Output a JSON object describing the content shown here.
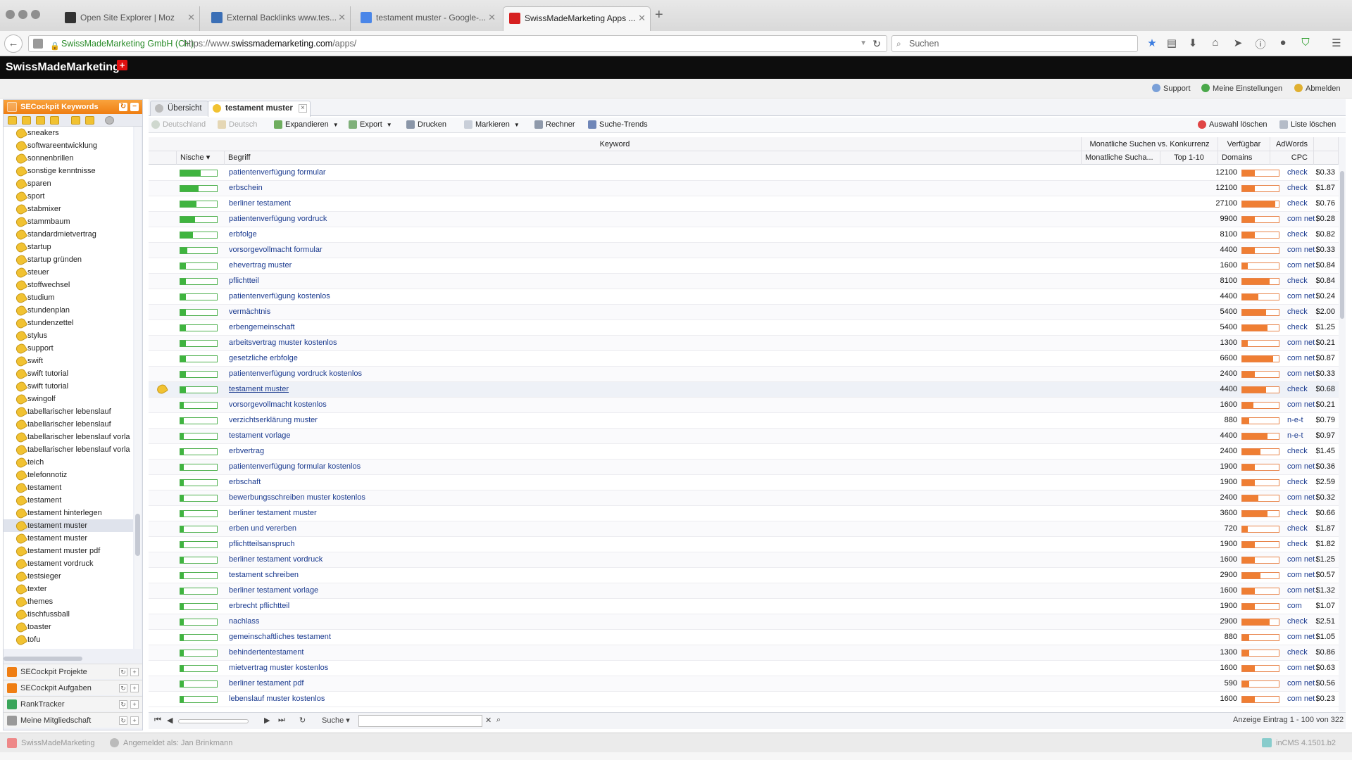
{
  "browser": {
    "tabs": [
      {
        "title": "Open Site Explorer | Moz",
        "active": false
      },
      {
        "title": "External Backlinks www.tes...",
        "active": false
      },
      {
        "title": "testament muster - Google-...",
        "active": false
      },
      {
        "title": "SwissMadeMarketing Apps ...",
        "active": true
      }
    ],
    "new_tab": "+",
    "url_org": "SwissMadeMarketing GmbH (CH)",
    "url_prefix": "https://www.",
    "url_domain": "swissmademarketing.com",
    "url_path": "/apps/",
    "search_placeholder": "Suchen"
  },
  "app": {
    "brand": "SwissMadeMarketing",
    "brand_flag": "+",
    "links": {
      "support": "Support",
      "settings": "Meine Einstellungen",
      "logout": "Abmelden"
    }
  },
  "sidebar": {
    "title": "SECockpit Keywords",
    "keywords": [
      "sneakers",
      "softwareentwicklung",
      "sonnenbrillen",
      "sonstige kenntnisse",
      "sparen",
      "sport",
      "stabmixer",
      "stammbaum",
      "standardmietvertrag",
      "startup",
      "startup gründen",
      "steuer",
      "stoffwechsel",
      "studium",
      "stundenplan",
      "stundenzettel",
      "stylus",
      "support",
      "swift",
      "swift tutorial",
      "swift tutorial",
      "swingolf",
      "tabellarischer lebenslauf",
      "tabellarischer lebenslauf",
      "tabellarischer lebenslauf vorla",
      "tabellarischer lebenslauf vorla",
      "teich",
      "telefonnotiz",
      "testament",
      "testament",
      "testament hinterlegen",
      "testament muster",
      "testament muster",
      "testament muster pdf",
      "testament vordruck",
      "testsieger",
      "texter",
      "themes",
      "tischfussball",
      "toaster",
      "tofu"
    ],
    "selected_index": 31,
    "sections": [
      "SECockpit Projekte",
      "SECockpit Aufgaben",
      "RankTracker",
      "Meine Mitgliedschaft"
    ]
  },
  "content": {
    "tabs": {
      "overview": "Übersicht",
      "active": "testament muster",
      "close": "×"
    },
    "toolbar": {
      "country": "Deutschland",
      "language": "Deutsch",
      "expand": "Expandieren",
      "export": "Export",
      "print": "Drucken",
      "mark": "Markieren",
      "calculator": "Rechner",
      "trends": "Suche-Trends",
      "clear_selection": "Auswahl löschen",
      "clear_list": "Liste löschen"
    },
    "groups": {
      "keyword": "Keyword",
      "monthly": "Monatliche Suchen vs. Konkurrenz",
      "available": "Verfügbar",
      "adwords": "AdWords"
    },
    "columns": {
      "niche": "Nische",
      "term": "Begriff",
      "monthly": "Monatliche Sucha...",
      "top": "Top 1-10",
      "domains": "Domains",
      "cpc": "CPC"
    },
    "rows": [
      {
        "term": "patientenverfügung formular",
        "volume": "12100",
        "domains": "check",
        "cpc": "$0.33",
        "niche": 0.55,
        "comp": 0.35
      },
      {
        "term": "erbschein",
        "volume": "12100",
        "domains": "check",
        "cpc": "$1.87",
        "niche": 0.5,
        "comp": 0.35
      },
      {
        "term": "berliner testament",
        "volume": "27100",
        "domains": "check",
        "cpc": "$0.76",
        "niche": 0.45,
        "comp": 0.9
      },
      {
        "term": "patientenverfügung vordruck",
        "volume": "9900",
        "domains": "com net",
        "cpc": "$0.28",
        "niche": 0.4,
        "comp": 0.35
      },
      {
        "term": "erbfolge",
        "volume": "8100",
        "domains": "check",
        "cpc": "$0.82",
        "niche": 0.35,
        "comp": 0.35
      },
      {
        "term": "vorsorgevollmacht formular",
        "volume": "4400",
        "domains": "com net",
        "cpc": "$0.33",
        "niche": 0.2,
        "comp": 0.35
      },
      {
        "term": "ehevertrag muster",
        "volume": "1600",
        "domains": "com net",
        "cpc": "$0.84",
        "niche": 0.15,
        "comp": 0.15
      },
      {
        "term": "pflichtteil",
        "volume": "8100",
        "domains": "check",
        "cpc": "$0.84",
        "niche": 0.15,
        "comp": 0.75
      },
      {
        "term": "patientenverfügung kostenlos",
        "volume": "4400",
        "domains": "com net",
        "cpc": "$0.24",
        "niche": 0.15,
        "comp": 0.45
      },
      {
        "term": "vermächtnis",
        "volume": "5400",
        "domains": "check",
        "cpc": "$2.00",
        "niche": 0.15,
        "comp": 0.65
      },
      {
        "term": "erbengemeinschaft",
        "volume": "5400",
        "domains": "check",
        "cpc": "$1.25",
        "niche": 0.15,
        "comp": 0.7
      },
      {
        "term": "arbeitsvertrag muster kostenlos",
        "volume": "1300",
        "domains": "com net",
        "cpc": "$0.21",
        "niche": 0.15,
        "comp": 0.15
      },
      {
        "term": "gesetzliche erbfolge",
        "volume": "6600",
        "domains": "com net",
        "cpc": "$0.87",
        "niche": 0.15,
        "comp": 0.85
      },
      {
        "term": "patientenverfügung vordruck kostenlos",
        "volume": "2400",
        "domains": "com net",
        "cpc": "$0.33",
        "niche": 0.15,
        "comp": 0.35
      },
      {
        "term": "testament muster",
        "volume": "4400",
        "domains": "check",
        "cpc": "$0.68",
        "niche": 0.15,
        "comp": 0.65
      },
      {
        "term": "vorsorgevollmacht kostenlos",
        "volume": "1600",
        "domains": "com net",
        "cpc": "$0.21",
        "niche": 0.1,
        "comp": 0.3
      },
      {
        "term": "verzichtserklärung muster",
        "volume": "880",
        "domains": "n-e-t",
        "cpc": "$0.79",
        "niche": 0.1,
        "comp": 0.2
      },
      {
        "term": "testament vorlage",
        "volume": "4400",
        "domains": "n-e-t",
        "cpc": "$0.97",
        "niche": 0.1,
        "comp": 0.7
      },
      {
        "term": "erbvertrag",
        "volume": "2400",
        "domains": "check",
        "cpc": "$1.45",
        "niche": 0.1,
        "comp": 0.5
      },
      {
        "term": "patientenverfügung formular kostenlos",
        "volume": "1900",
        "domains": "com net",
        "cpc": "$0.36",
        "niche": 0.1,
        "comp": 0.35
      },
      {
        "term": "erbschaft",
        "volume": "1900",
        "domains": "check",
        "cpc": "$2.59",
        "niche": 0.1,
        "comp": 0.35
      },
      {
        "term": "bewerbungsschreiben muster kostenlos",
        "volume": "2400",
        "domains": "com net",
        "cpc": "$0.32",
        "niche": 0.1,
        "comp": 0.45
      },
      {
        "term": "berliner testament muster",
        "volume": "3600",
        "domains": "check",
        "cpc": "$0.66",
        "niche": 0.1,
        "comp": 0.7
      },
      {
        "term": "erben und vererben",
        "volume": "720",
        "domains": "check",
        "cpc": "$1.87",
        "niche": 0.1,
        "comp": 0.15
      },
      {
        "term": "pflichtteilsanspruch",
        "volume": "1900",
        "domains": "check",
        "cpc": "$1.82",
        "niche": 0.1,
        "comp": 0.35
      },
      {
        "term": "berliner testament vordruck",
        "volume": "1600",
        "domains": "com net",
        "cpc": "$1.25",
        "niche": 0.1,
        "comp": 0.35
      },
      {
        "term": "testament schreiben",
        "volume": "2900",
        "domains": "com net",
        "cpc": "$0.57",
        "niche": 0.1,
        "comp": 0.5
      },
      {
        "term": "berliner testament vorlage",
        "volume": "1600",
        "domains": "com net",
        "cpc": "$1.32",
        "niche": 0.1,
        "comp": 0.35
      },
      {
        "term": "erbrecht pflichtteil",
        "volume": "1900",
        "domains": "com",
        "cpc": "$1.07",
        "niche": 0.1,
        "comp": 0.35
      },
      {
        "term": "nachlass",
        "volume": "2900",
        "domains": "check",
        "cpc": "$2.51",
        "niche": 0.1,
        "comp": 0.75
      },
      {
        "term": "gemeinschaftliches testament",
        "volume": "880",
        "domains": "com net",
        "cpc": "$1.05",
        "niche": 0.1,
        "comp": 0.2
      },
      {
        "term": "behindertentestament",
        "volume": "1300",
        "domains": "check",
        "cpc": "$0.86",
        "niche": 0.1,
        "comp": 0.2
      },
      {
        "term": "mietvertrag muster kostenlos",
        "volume": "1600",
        "domains": "com net",
        "cpc": "$0.63",
        "niche": 0.1,
        "comp": 0.35
      },
      {
        "term": "berliner testament pdf",
        "volume": "590",
        "domains": "com net",
        "cpc": "$0.56",
        "niche": 0.1,
        "comp": 0.2
      },
      {
        "term": "lebenslauf muster kostenlos",
        "volume": "1600",
        "domains": "com net",
        "cpc": "$0.23",
        "niche": 0.1,
        "comp": 0.35
      }
    ],
    "hover_index": 14,
    "pager": {
      "search_label": "Suche",
      "summary": "Anzeige Eintrag 1 - 100 von 322"
    }
  },
  "status": {
    "brand": "SwissMadeMarketing",
    "user": "Angemeldet als: Jan Brinkmann",
    "version": "inCMS 4.1501.b2"
  }
}
